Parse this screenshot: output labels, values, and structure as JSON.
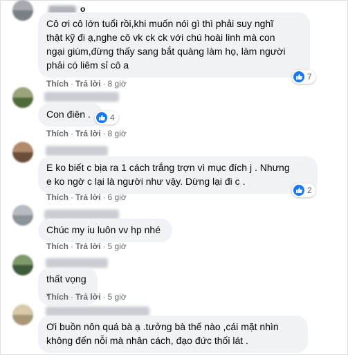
{
  "colors": {
    "bubble": "#f0f2f5",
    "like_blue": "#1877f2",
    "meta_text": "#65676b",
    "body_text": "#050505"
  },
  "actions": {
    "like": "Thích",
    "reply": "Trả lời",
    "separator": "·"
  },
  "comments": [
    {
      "name_visible": "o",
      "text": "Cô ơi cô lớn tuổi rồi,khi muốn nói gì thì phải suy nghĩ\nthật kỹ đi ạ,nghe cô vk ck ck với chú hoài linh mà con\nngại giùm,đừng thấy sang bắt quàng làm họ, làm người\nphải có liêm sỉ cô a",
      "reactions": "7",
      "time": "8 giờ"
    },
    {
      "text": "Con điên .",
      "reactions": "4",
      "time": "8 giờ"
    },
    {
      "text": "E ko biết c bịa ra 1 cách trắng trợn vì mục đích j . Nhưng\ne ko ngờ c lại là người như vậy. Dừng lại đi c .",
      "reactions": "2",
      "time": "6 giờ"
    },
    {
      "text": "Chúc my iu luôn vv hp nhé",
      "time": "5 giờ"
    },
    {
      "text": "thất vọng .",
      "time": "5 giờ"
    },
    {
      "text": "Ơi buồn nôn quá bà ạ .tưởng bà thế nào ,cái mặt nhìn\nkhông đến nỗi mà nhân cách, đạo đức thối lát .",
      "time": ""
    }
  ]
}
